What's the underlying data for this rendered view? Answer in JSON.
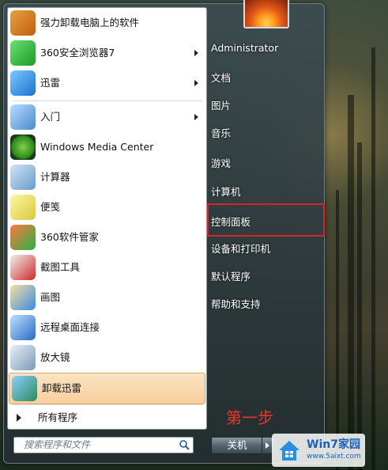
{
  "start_menu": {
    "left_items": [
      {
        "label": "强力卸载电脑上的软件",
        "icon": "uninstaller-icon",
        "arrow": false,
        "highlight": false
      },
      {
        "label": "360安全浏览器7",
        "icon": "360-browser-icon",
        "arrow": true,
        "highlight": false
      },
      {
        "label": "迅雷",
        "icon": "xunlei-icon",
        "arrow": true,
        "highlight": false
      },
      {
        "label": "入门",
        "icon": "getting-started-icon",
        "arrow": true,
        "highlight": false
      },
      {
        "label": "Windows Media Center",
        "icon": "media-center-icon",
        "arrow": false,
        "highlight": false
      },
      {
        "label": "计算器",
        "icon": "calculator-icon",
        "arrow": false,
        "highlight": false
      },
      {
        "label": "便笺",
        "icon": "sticky-notes-icon",
        "arrow": false,
        "highlight": false
      },
      {
        "label": "360软件管家",
        "icon": "360-software-manager-icon",
        "arrow": false,
        "highlight": false
      },
      {
        "label": "截图工具",
        "icon": "snipping-tool-icon",
        "arrow": false,
        "highlight": false
      },
      {
        "label": "画图",
        "icon": "paint-icon",
        "arrow": false,
        "highlight": false
      },
      {
        "label": "远程桌面连接",
        "icon": "remote-desktop-icon",
        "arrow": false,
        "highlight": false
      },
      {
        "label": "放大镜",
        "icon": "magnifier-icon",
        "arrow": false,
        "highlight": false
      },
      {
        "label": "卸载迅雷",
        "icon": "uninstall-xunlei-icon",
        "arrow": false,
        "highlight": true
      }
    ],
    "all_programs_label": "所有程序",
    "search_placeholder": "搜索程序和文件",
    "right_items": [
      "Administrator",
      "文档",
      "图片",
      "音乐",
      "游戏",
      "计算机",
      "控制面板",
      "设备和打印机",
      "默认程序",
      "帮助和支持"
    ],
    "shutdown_label": "关机"
  },
  "annotation": {
    "step_label": "第一步",
    "highlight_color": "#d6232a"
  },
  "watermark": {
    "title": "Win7家园",
    "url": "www.5aixt.com"
  }
}
